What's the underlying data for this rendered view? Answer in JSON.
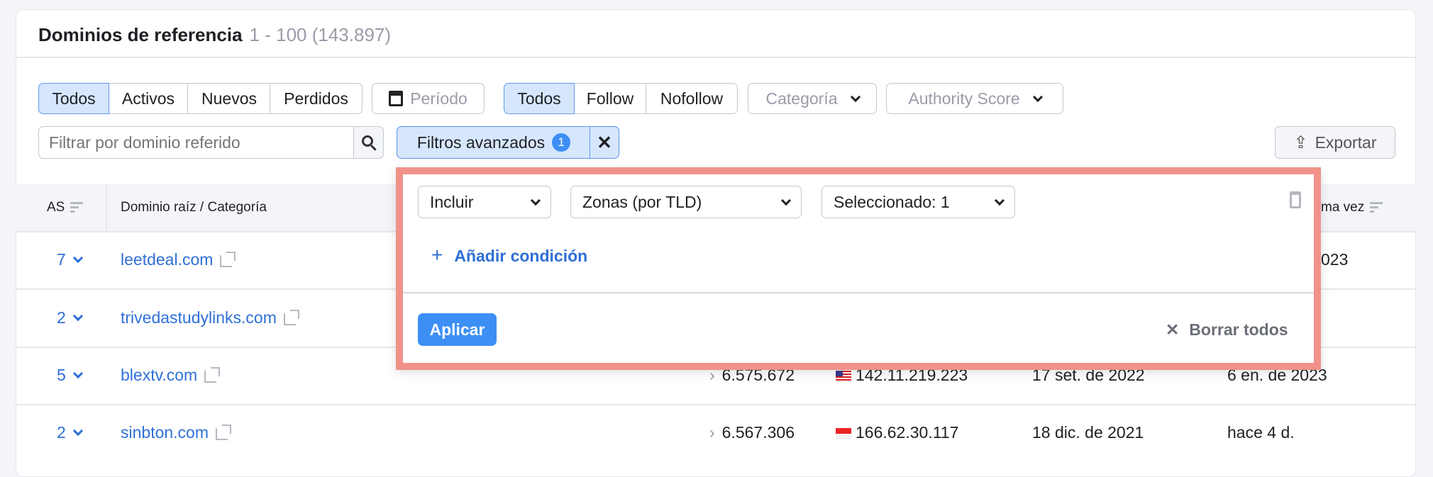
{
  "header": {
    "title": "Dominios de referencia",
    "count": "1 - 100 (143.897)"
  },
  "filters": {
    "status": [
      "Todos",
      "Activos",
      "Nuevos",
      "Perdidos"
    ],
    "period": "Período",
    "link_type": [
      "Todos",
      "Follow",
      "Nofollow"
    ],
    "category": "Categoría",
    "authority": "Authority Score",
    "search_placeholder": "Filtrar por dominio referido",
    "advanced": "Filtros avanzados",
    "advanced_count": "1",
    "export": "Exportar"
  },
  "table": {
    "headers": {
      "as": "AS",
      "domain": "Dominio raíz / Categoría",
      "last": "ma vez"
    },
    "rows": [
      {
        "as": "7",
        "domain": "leetdeal.com",
        "last": "023"
      },
      {
        "as": "2",
        "domain": "trivedastudylinks.com"
      },
      {
        "as": "5",
        "domain": "blextv.com",
        "backlinks": "6.575.672",
        "flag": "us",
        "ip": "142.11.219.223",
        "first": "17 set. de 2022",
        "last": "6 en. de 2023"
      },
      {
        "as": "2",
        "domain": "sinbton.com",
        "backlinks": "6.567.306",
        "flag": "sg",
        "ip": "166.62.30.117",
        "first": "18 dic. de 2021",
        "last": "hace 4 d."
      }
    ]
  },
  "popup": {
    "include": "Incluir",
    "field": "Zonas (por TLD)",
    "selected": "Seleccionado: 1",
    "add_condition": "Añadir condición",
    "apply": "Aplicar",
    "clear_all": "Borrar todos"
  },
  "colors": {
    "accent": "#3d8ff5",
    "link": "#2f6fd6",
    "highlight_border": "#f0928a"
  }
}
